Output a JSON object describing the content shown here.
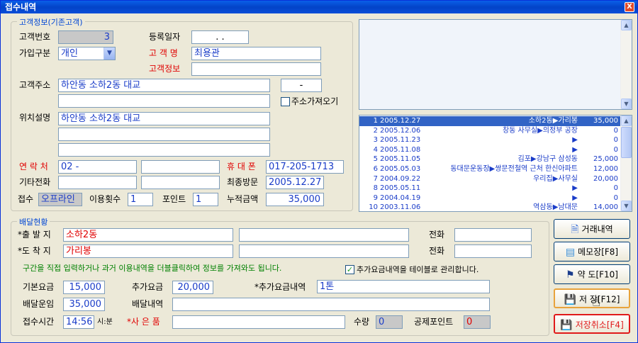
{
  "window": {
    "title": "접수내역",
    "close_label": "X"
  },
  "customer": {
    "group_title": "고객정보(기존고객)",
    "id_label": "고객번호",
    "id_value": "3",
    "regdate_label": "등록일자",
    "regdate_value": ".   .",
    "type_label": "가입구분",
    "type_value": "개인",
    "name_label": "고 객 명",
    "name_value": "최용관",
    "info_label": "고객정보",
    "info_value": "",
    "addr_label": "고객주소",
    "addr_value": "하안동 소하2동 대교",
    "zip_value": "-",
    "addr2_value": "",
    "fetch_addr_label": "주소가져오기",
    "loc_label": "위치설명",
    "loc_value": "하안동 소하2동 대교",
    "loc2_value": "",
    "loc3_value": "",
    "contact_label": "연 락 처",
    "contact_value": "02  -",
    "contact2_value": "",
    "mobile_label": "휴 대 폰",
    "mobile_value": "017-205-1713",
    "other_phone_label": "기타전화",
    "other_phone_value": "",
    "other_phone2_value": "",
    "last_visit_label": "최종방문",
    "last_visit_value": "2005.12.27",
    "receipt_label": "접수",
    "receipt_value": "오프라인",
    "use_count_label": "이용횟수",
    "use_count_value": "1",
    "points_label": "포인트",
    "points_value": "1",
    "total_label": "누적금액",
    "total_value": "35,000"
  },
  "history": [
    {
      "no": "1",
      "date": "2005.12.27",
      "route": "소하2동▶가리봉",
      "amount": "35,000"
    },
    {
      "no": "2",
      "date": "2005.12.06",
      "route": "창동 사무실▶의정부 공장",
      "amount": "0"
    },
    {
      "no": "3",
      "date": "2005.11.23",
      "route": "▶",
      "amount": "0"
    },
    {
      "no": "4",
      "date": "2005.11.08",
      "route": "▶",
      "amount": "0"
    },
    {
      "no": "5",
      "date": "2005.11.05",
      "route": "김포▶강남구 삼성동",
      "amount": "25,000"
    },
    {
      "no": "6",
      "date": "2005.05.03",
      "route": "동대문운동장▶쌍문전철역 근처 한신아파트",
      "amount": "12,000"
    },
    {
      "no": "7",
      "date": "2004.09.22",
      "route": "우리집▶사무실",
      "amount": "20,000"
    },
    {
      "no": "8",
      "date": "2005.05.11",
      "route": "▶",
      "amount": "0"
    },
    {
      "no": "9",
      "date": "2004.04.19",
      "route": "▶",
      "amount": "0"
    },
    {
      "no": "10",
      "date": "2003.11.06",
      "route": "역삼동▶남대문",
      "amount": "14,000"
    }
  ],
  "delivery": {
    "group_title": "배달현황",
    "origin_label": "*출 발 지",
    "origin_value": "소하2동",
    "origin2_value": "",
    "origin_phone_label": "전화",
    "origin_phone_value": "",
    "dest_label": "*도 착 지",
    "dest_value": "가리봉",
    "dest2_value": "",
    "dest_phone_label": "전화",
    "dest_phone_value": "",
    "hint": "구간을 직접 입력하거나 과거 이용내역을 더블클릭하여 정보를 가져와도 됩니다.",
    "extra_table_label": "추가요금내역을 테이블로 관리합니다.",
    "extra_table_checked": true,
    "base_fee_label": "기본요금",
    "base_fee_value": "15,000",
    "extra_fee_label": "추가요금",
    "extra_fee_value": "20,000",
    "extra_detail_label": "*추가요금내역",
    "extra_detail_value": "1톤",
    "delivery_fee_label": "배달운임",
    "delivery_fee_value": "35,000",
    "delivery_detail_label": "배달내역",
    "delivery_detail_value": "",
    "time_label": "접수시간",
    "time_value": "14:56",
    "time_unit": "시:분",
    "item_label": "*사 은 품",
    "item_value": "",
    "qty_label": "수량",
    "qty_value": "0",
    "deduct_label": "공제포인트",
    "deduct_value": "0"
  },
  "buttons": {
    "history": "거래내역",
    "memo": "메모장[F8]",
    "map": "약 도[F10]",
    "save": "저 장[F12]",
    "cancel": "저장취소[F4]"
  },
  "colors": {
    "accent": "#0046d5",
    "alert": "#e00000",
    "value": "#1a3cc8",
    "selection": "#3163c5"
  }
}
